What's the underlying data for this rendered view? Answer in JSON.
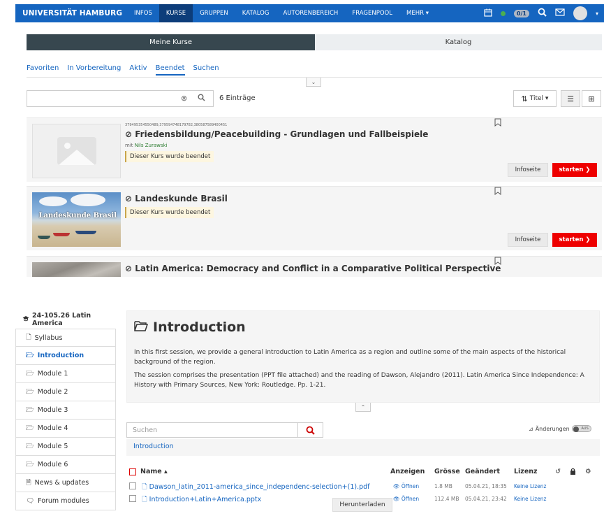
{
  "topnav": {
    "brand": "UNIVERSITÄT HAMBURG",
    "items": [
      "INFOS",
      "KURSE",
      "GRUPPEN",
      "KATALOG",
      "AUTORENBEREICH",
      "FRAGENPOOL",
      "MEHR ▾"
    ],
    "active": "KURSE",
    "notify_count": "0/1"
  },
  "modetabs": [
    "Meine Kurse",
    "Katalog"
  ],
  "subtabs": [
    "Favoriten",
    "In Vorbereitung",
    "Aktiv",
    "Beendet",
    "Suchen"
  ],
  "search": {
    "placeholder": "",
    "count": "6 Einträge",
    "sort_label": "Titel ▾"
  },
  "courses": [
    {
      "code": "379495354550489,379594748179782,380587589400451",
      "title": "⊘ Friedensbildung/Peacebuilding - Grundlagen und Fallbeispiele",
      "by_prefix": "mit ",
      "by_name": "Nils Zurawski",
      "status": "Dieser Kurs wurde beendet",
      "info": "Infoseite",
      "start": "starten ❯"
    },
    {
      "title": "⊘ Landeskunde Brasil",
      "thumb_title": "Landeskunde Brasil",
      "status": "Dieser Kurs wurde beendet",
      "info": "Infoseite",
      "start": "starten ❯"
    },
    {
      "title": "⊘ Latin America: Democracy and Conflict in a Comparative Political Perspective"
    }
  ],
  "course_nav": {
    "title": "24-105.26 Latin America",
    "items": [
      "Syllabus",
      "Introduction",
      "Module 1",
      "Module 2",
      "Module 3",
      "Module 4",
      "Module 5",
      "Module 6",
      "News & updates",
      "Forum modules"
    ],
    "active": "Introduction"
  },
  "page": {
    "title": "Introduction",
    "p1": "In this first session, we provide a general introduction to Latin America as a region and outline some of the main aspects of the historical background of the region.",
    "p2": "The session comprises the presentation (PPT file attached) and the reading of Dawson, Alejandro (2011). Latin America Since Independence: A History with Primary Sources, New York: Routledge. Pp. 1-21."
  },
  "files": {
    "search_placeholder": "Suchen",
    "changes_label": "Änderungen",
    "toggle_label": "AUS",
    "breadcrumb": "Introduction",
    "headers": {
      "name": "Name ▴",
      "show": "Anzeigen",
      "size": "Grösse",
      "changed": "Geändert",
      "license": "Lizenz"
    },
    "rows": [
      {
        "name": "Dawson_latin_2011-america_since_independenc-selection+(1).pdf",
        "show": "👁 Öffnen",
        "size": "1.8 MB",
        "changed": "05.04.21, 18:35",
        "license": "Keine Lizenz"
      },
      {
        "name": "Introduction+Latin+America.pptx",
        "show": "👁 Öffnen",
        "size": "112.4 MB",
        "changed": "05.04.21, 23:42",
        "license": "Keine Lizenz"
      }
    ],
    "download": "Herunterladen"
  }
}
